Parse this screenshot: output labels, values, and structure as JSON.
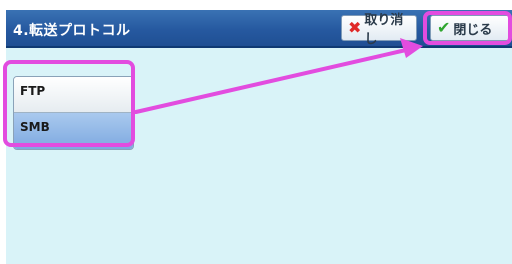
{
  "titlebar": {
    "title": "4.転送プロトコル"
  },
  "buttons": {
    "cancel": {
      "label": "取り消し",
      "icon": "x-icon"
    },
    "close": {
      "label": "閉じる",
      "icon": "check-icon"
    }
  },
  "protocol_list": {
    "options": [
      {
        "label": "FTP",
        "selected": false
      },
      {
        "label": "SMB",
        "selected": true
      }
    ]
  },
  "annotation": {
    "color": "#e24cdf"
  }
}
